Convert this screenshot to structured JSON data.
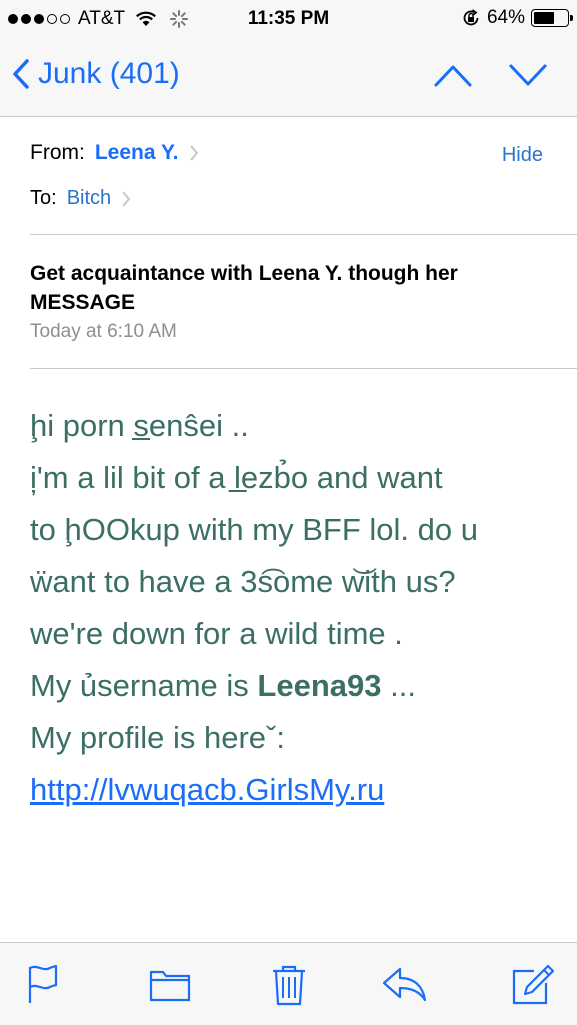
{
  "status": {
    "carrier": "AT&T",
    "time": "11:35 PM",
    "battery_percent": "64%",
    "battery_level": 0.64
  },
  "nav": {
    "back_label": "Junk (401)"
  },
  "message": {
    "from_label": "From:",
    "from_name": "Leena Y.",
    "hide_label": "Hide",
    "to_label": "To:",
    "to_name": "Bitch",
    "subject": "Get acquaintance with Leena Y. though her MESSAGE",
    "date": "Today at 6:10 AM",
    "body_lines": [
      "ḩi porn s̲enŝei ..",
      "i̦'m a lil bit of a l̲ezb̉o and want",
      "to ḩOOkup with my BFF lol. do u",
      "ẅant to have a 3s͡ome w͝ith us?",
      "we're down for a wild time .",
      "My ủsername is",
      "My profile is hereˇ:"
    ],
    "username": "Leena93",
    "username_suffix": " ...",
    "link": "http://lvwuqacb.GirlsMy.ru"
  },
  "icons": {
    "back": "chevron-left-icon",
    "prev": "chevron-up-icon",
    "next": "chevron-down-icon",
    "flag": "flag-icon",
    "folder": "folder-icon",
    "trash": "trash-icon",
    "reply": "reply-icon",
    "compose": "compose-icon"
  },
  "colors": {
    "accent": "#1a6df7",
    "body_text": "#3b6f65",
    "secondary_text": "#8e8e93"
  }
}
